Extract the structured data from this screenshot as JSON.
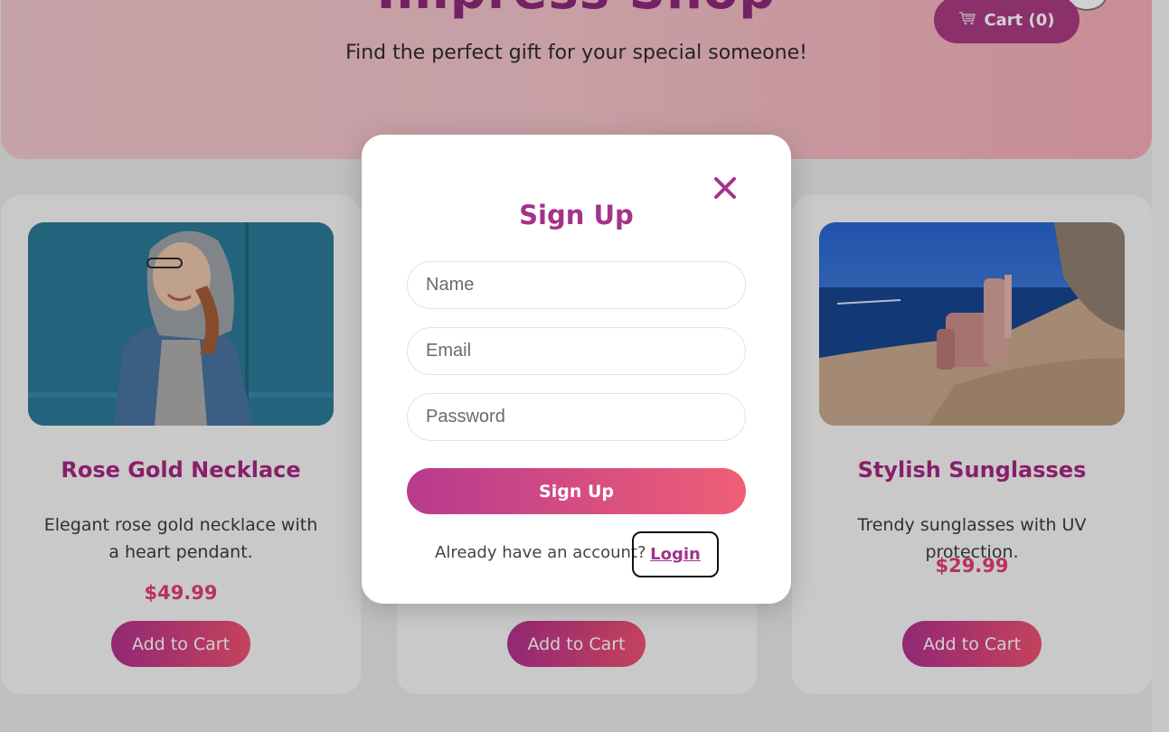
{
  "header": {
    "title": "Impress Shop",
    "tagline": "Find the perfect gift for your special someone!",
    "cart": {
      "icon": "cart-icon",
      "label": "Cart (0)"
    }
  },
  "products": [
    {
      "name": "Rose Gold Necklace",
      "description": "Elegant rose gold necklace with a heart pendant.",
      "price": "$49.99",
      "button": "Add to Cart",
      "image": "woman-in-denim-jacket-photo"
    },
    {
      "button": "Add to Cart"
    },
    {
      "name": "Stylish Sunglasses",
      "description": "Trendy sunglasses with UV protection.",
      "price": "$29.99",
      "button": "Add to Cart",
      "image": "armchair-on-seaside-cliff-photo"
    }
  ],
  "modal": {
    "title": "Sign Up",
    "close_icon": "close-icon",
    "fields": {
      "name": {
        "placeholder": "Name",
        "value": ""
      },
      "email": {
        "placeholder": "Email",
        "value": ""
      },
      "password": {
        "placeholder": "Password",
        "value": ""
      }
    },
    "submit_label": "Sign Up",
    "login_prompt": "Already have an account?",
    "login_link": "Login"
  },
  "colors": {
    "brand": "#a4338a",
    "price": "#e0356a",
    "gradient_start": "#b83a8e",
    "gradient_end": "#f05f76",
    "header_bg": "#f4c0c8"
  }
}
